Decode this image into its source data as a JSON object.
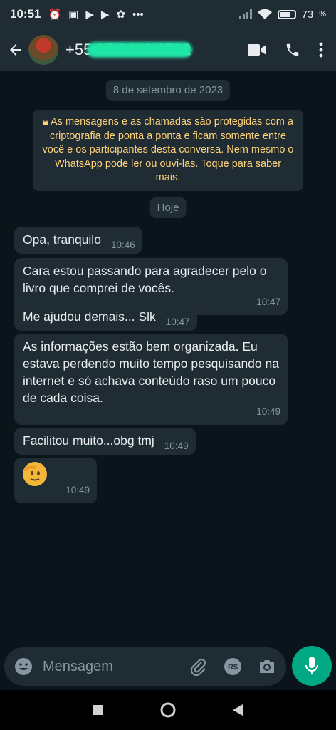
{
  "status_bar": {
    "time": "10:51",
    "battery": "73"
  },
  "header": {
    "contact": "+55 27 9112 6722"
  },
  "chat": {
    "date_pill": "8 de setembro de 2023",
    "encryption_notice": "As mensagens e as chamadas são protegidas com a criptografia de ponta a ponta e ficam somente entre você e os participantes desta conversa. Nem mesmo o WhatsApp pode ler ou ouvi-las. Toque para saber mais.",
    "today_pill": "Hoje",
    "messages": [
      {
        "text": "Opa, tranquilo",
        "time": "10:46"
      },
      {
        "text": "Cara estou passando para agradecer pelo o livro que comprei de vocês.",
        "time": "10:47"
      },
      {
        "text": "Me ajudou demais... Slk",
        "time": "10:47"
      },
      {
        "text": "As informações estão bem organizada. Eu estava perdendo muito tempo pesquisando na internet e só achava conteúdo raso um pouco de cada coisa.",
        "time": "10:49"
      },
      {
        "text": "Facilitou muito...obg tmj",
        "time": "10:49"
      },
      {
        "text": "",
        "time": "10:49"
      }
    ]
  },
  "composer": {
    "placeholder": "Mensagem"
  },
  "colors": {
    "accent": "#00a884",
    "bubble": "#202c33",
    "encrypt_text": "#ffd279"
  }
}
